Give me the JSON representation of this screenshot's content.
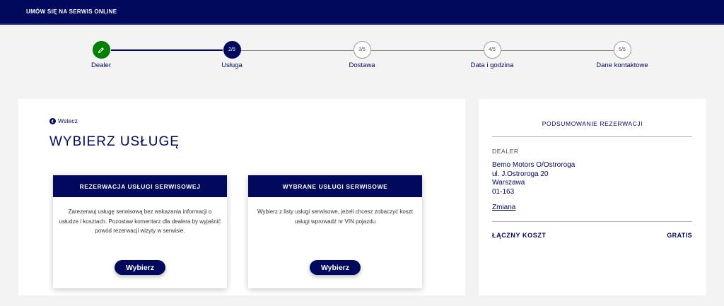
{
  "header": {
    "title": "UMÓW SIĘ NA SERWIS ONLINE"
  },
  "stepper": {
    "steps": [
      {
        "badge": "",
        "label": "Dealer",
        "state": "done",
        "icon": "pencil-icon"
      },
      {
        "badge": "2/5",
        "label": "Usługa",
        "state": "current"
      },
      {
        "badge": "3/5",
        "label": "Dostawa",
        "state": "pending"
      },
      {
        "badge": "4/5",
        "label": "Data i godzina",
        "state": "pending"
      },
      {
        "badge": "5/5",
        "label": "Dane kontaktowe",
        "state": "pending"
      }
    ]
  },
  "main": {
    "back_label": "Wstecz",
    "title": "WYBIERZ USŁUGĘ",
    "cards": [
      {
        "title": "REZERWACJA USŁUGI SERWISOWEJ",
        "description": "Zarezerwuj usługę serwisową bez wskazania informacji o usłudze i kosztach. Pozostaw komentarz dla dealera by wyjaśnić powód rezerwacji wizyty w serwisie.",
        "button_label": "Wybierz"
      },
      {
        "title": "WYBRANE USŁUGI SERWISOWE",
        "description": "Wybierz z listy usługi serwisowe, jeżeli chcesz zobaczyć koszt usługi wprowadź nr VIN pojazdu",
        "button_label": "Wybierz"
      }
    ]
  },
  "summary": {
    "title": "PODSUMOWANIE REZERWACJI",
    "dealer_label": "DEALER",
    "dealer_name": "Bemo Motors O/Ostroroga",
    "dealer_street": "ul. J.Ostroroga 20",
    "dealer_city": "Warszawa",
    "dealer_postal": "01-163",
    "change_link": "Zmiana",
    "total_label": "ŁĄCZNY KOSZT",
    "total_value": "GRATIS"
  },
  "colors": {
    "brand": "#00095b",
    "success": "#008200",
    "background": "#f3f3f3"
  }
}
